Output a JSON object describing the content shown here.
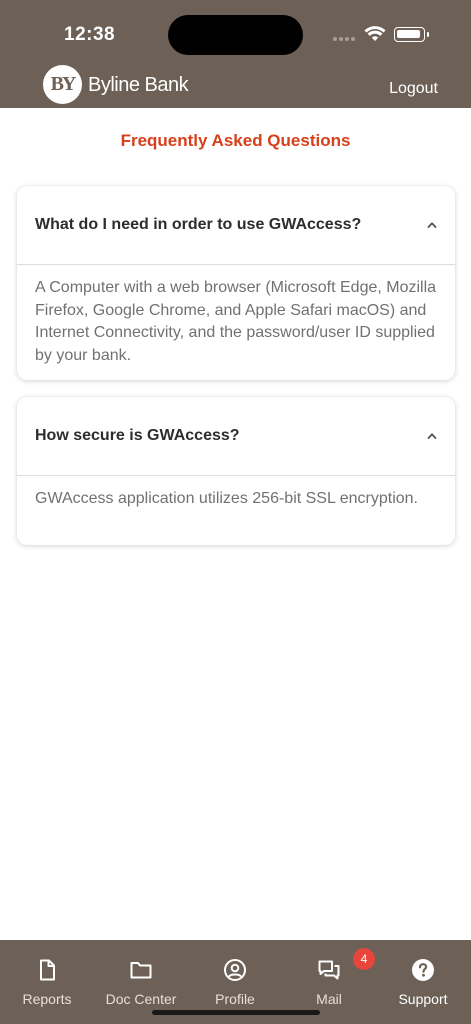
{
  "status_bar": {
    "time": "12:38"
  },
  "header": {
    "logo_mark": "BY",
    "logo_text": "Byline Bank",
    "logout_label": "Logout"
  },
  "page": {
    "title": "Frequently Asked Questions"
  },
  "faqs": [
    {
      "question": "What do I need in order to use GWAccess?",
      "answer": "A Computer with a web browser (Microsoft Edge, Mozilla Firefox, Google Chrome, and Apple Safari macOS) and Internet Connectivity, and the password/user ID supplied by your bank.",
      "expanded": true
    },
    {
      "question": "How secure is GWAccess?",
      "answer": "GWAccess application utilizes 256-bit SSL encryption.",
      "expanded": true
    }
  ],
  "tabbar": {
    "items": [
      {
        "label": "Reports",
        "icon": "document-icon"
      },
      {
        "label": "Doc Center",
        "icon": "folder-icon"
      },
      {
        "label": "Profile",
        "icon": "user-circle-icon"
      },
      {
        "label": "Mail",
        "icon": "chat-bubbles-icon",
        "badge": "4"
      },
      {
        "label": "Support",
        "icon": "help-circle-icon",
        "active": true
      }
    ]
  },
  "colors": {
    "header_bg": "#6d6157",
    "title_accent": "#d6401b",
    "badge": "#e8453c"
  }
}
